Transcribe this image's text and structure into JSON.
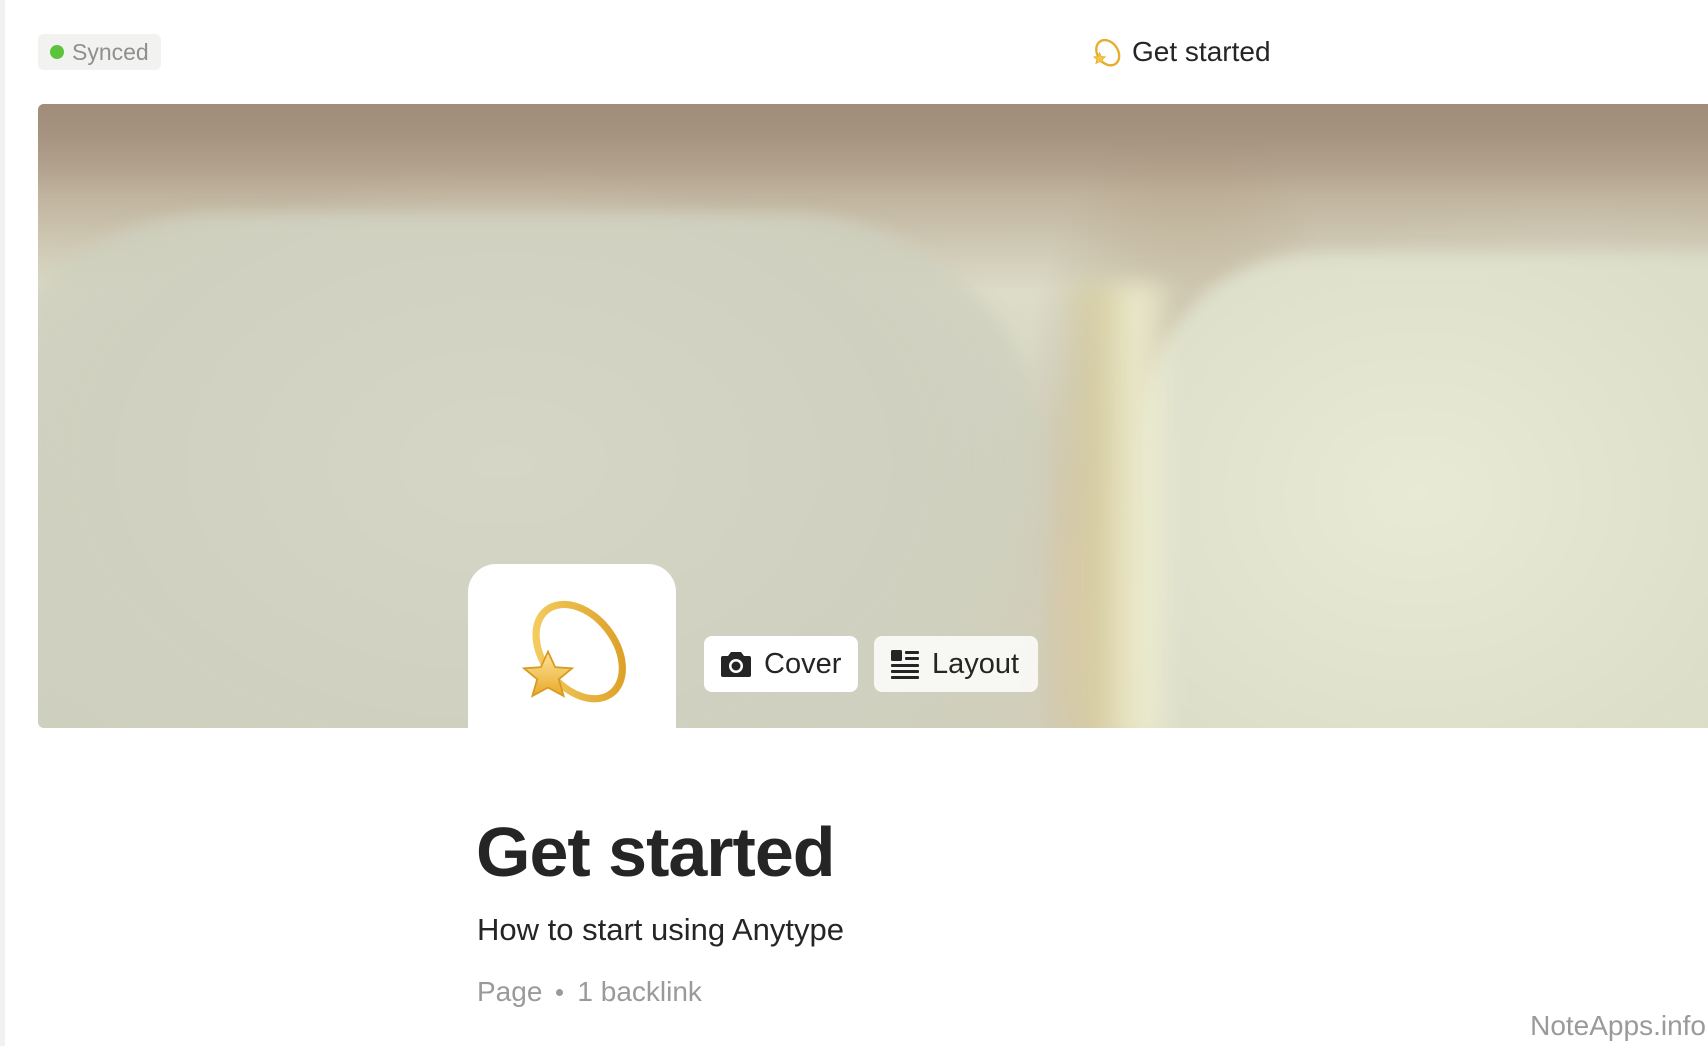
{
  "header": {
    "sync_status": "Synced",
    "sync_color": "#5cc43c",
    "title": "Get started",
    "title_icon": "dizzy-emoji-icon"
  },
  "cover": {
    "icon": "dizzy-emoji-icon",
    "cover_button_label": "Cover",
    "cover_button_icon": "camera-icon",
    "layout_button_label": "Layout",
    "layout_button_icon": "layout-icon"
  },
  "page": {
    "title": "Get started",
    "description": "How to start using Anytype",
    "type": "Page",
    "backlinks": "1 backlink"
  },
  "watermark": "NoteApps.info"
}
